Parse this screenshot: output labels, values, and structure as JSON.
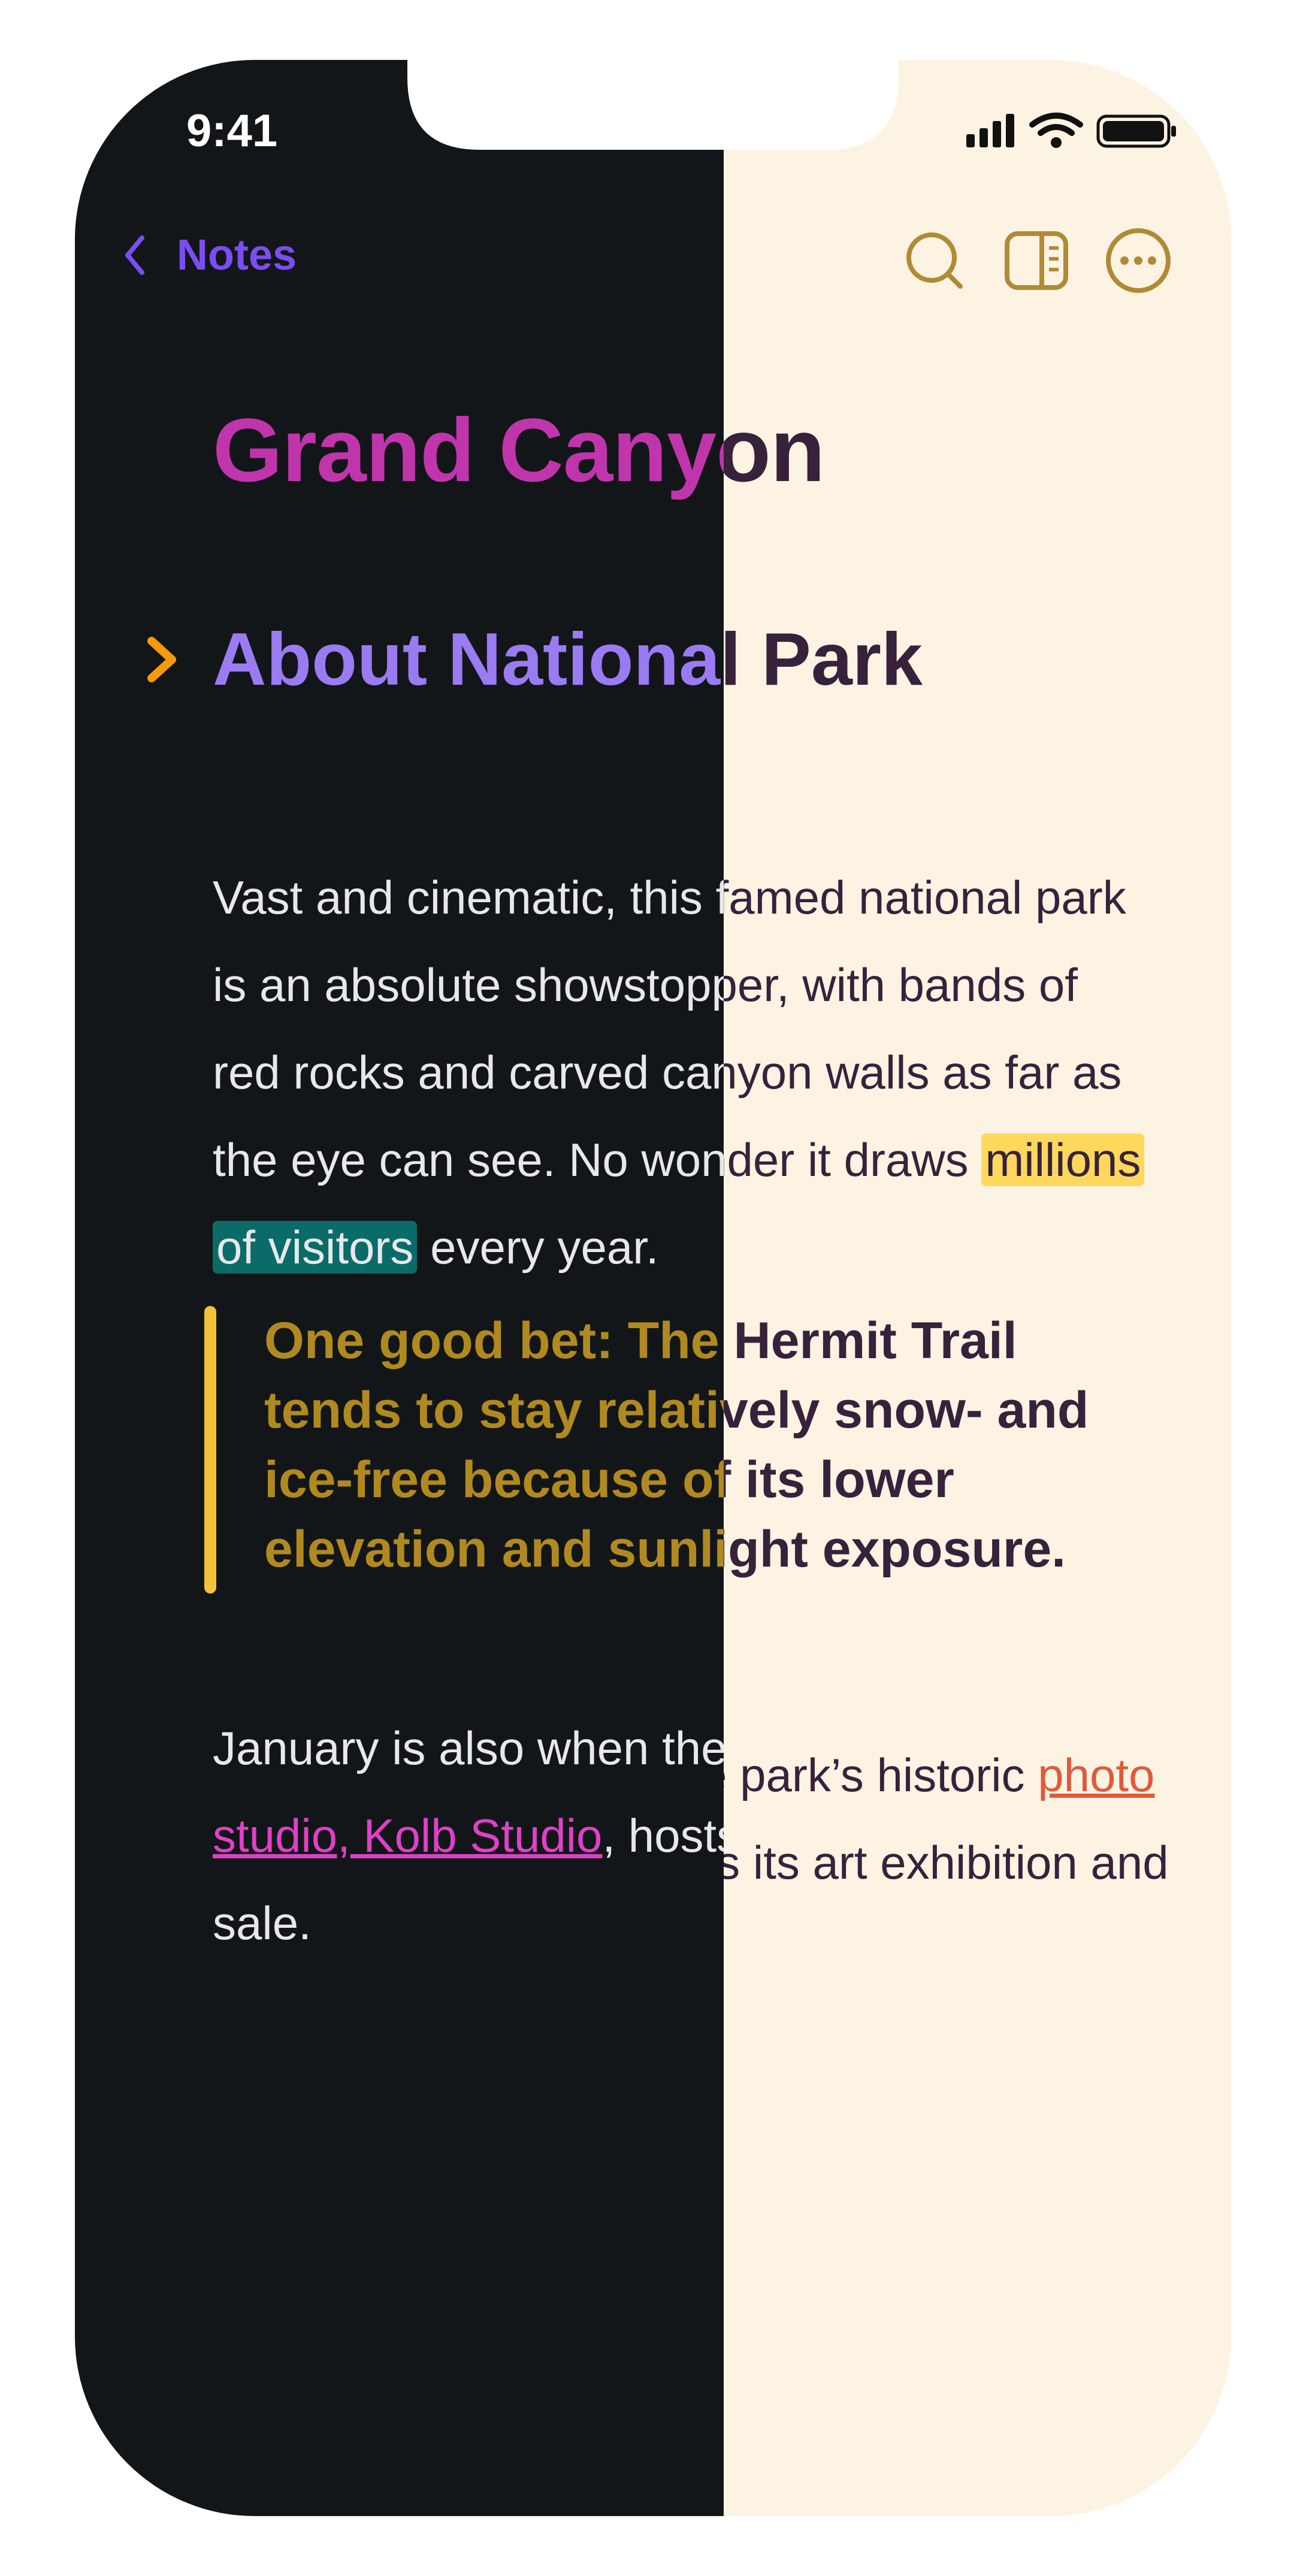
{
  "status_bar": {
    "time": "9:41"
  },
  "nav": {
    "back_label": "Notes",
    "back_icon": "chevron-left-icon",
    "actions": [
      "search-icon",
      "sidebar-toggle-icon",
      "more-options-icon"
    ]
  },
  "note": {
    "title": "Grand Canyon",
    "heading": "About National Park",
    "paragraph1": {
      "line1": "Vast and cinematic, this famed national park",
      "line2": "is an absolute showstopper, with bands of",
      "line3": "red rocks and carved canyon walls as far as",
      "line4_start": "the eye can see. No wonder it draws ",
      "highlight1": "millions",
      "highlight2": "of visitors",
      "line5_end": " every year."
    },
    "quote": {
      "line1": "One good bet: The Hermit Trail",
      "line2": "tends to stay relatively snow- and",
      "line3": "ice-free because of its lower",
      "line4": "elevation and sunlight exposure."
    },
    "paragraph2": {
      "start": "January is also when the park’s historic ",
      "link1": "photo",
      "link2": "studio, Kolb Studio",
      "middle": ", hosts its art exhibition and",
      "end": "sale."
    }
  },
  "colors": {
    "dark_bg": "#131619",
    "light_bg": "#fdf3e3",
    "accent_purple": "#7c4df0",
    "accent_gold": "#b08a35",
    "title_dark": "#c135ac",
    "heading_dark": "#9a7bf2",
    "text_light": "#37213b",
    "highlight_yellow": "#fdd85d",
    "highlight_teal": "#0a6b68",
    "link_dark": "#e040c8",
    "link_light": "#e05a3a"
  }
}
